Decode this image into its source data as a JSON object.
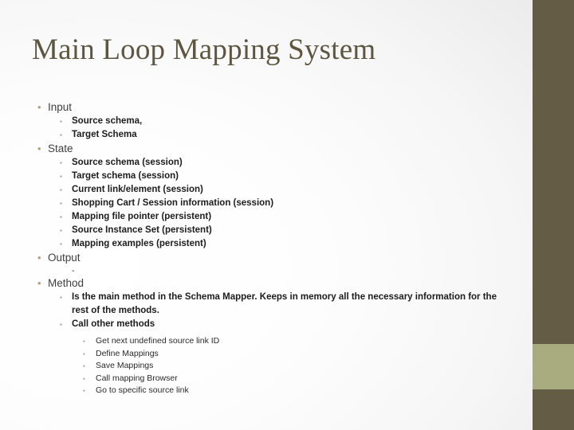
{
  "slide": {
    "title": "Main Loop Mapping System",
    "theme": {
      "title_color": "#5d5641",
      "bar_color": "#645c44",
      "bar_accent_color": "#a9ac7e",
      "level1_bullet_color": "#a9a383",
      "sub_bullet_color": "#8fa0a6",
      "background": "#ffffff"
    },
    "bullet_glyphs": {
      "level1": "•",
      "level2": "▪",
      "level3": "▪"
    },
    "outline": [
      {
        "level": 1,
        "text": "Input",
        "children": [
          {
            "level": 2,
            "text": "Source schema,"
          },
          {
            "level": 2,
            "text": "Target Schema"
          }
        ]
      },
      {
        "level": 1,
        "text": "State",
        "children": [
          {
            "level": 2,
            "text": "Source schema (session)"
          },
          {
            "level": 2,
            "text": "Target schema (session)"
          },
          {
            "level": 2,
            "text": "Current link/element (session)"
          },
          {
            "level": 2,
            "text": "Shopping Cart / Session information (session)"
          },
          {
            "level": 2,
            "text": "Mapping file pointer (persistent)"
          },
          {
            "level": 2,
            "text": "Source Instance Set (persistent)"
          },
          {
            "level": 2,
            "text": "Mapping examples (persistent)"
          }
        ]
      },
      {
        "level": 1,
        "text": "Output",
        "children": [
          {
            "level": 2,
            "text": "-",
            "style": "dash"
          }
        ]
      },
      {
        "level": 1,
        "text": "Method",
        "children": [
          {
            "level": 2,
            "text": "Is the main method in the Schema Mapper. Keeps in memory all the necessary information for the rest of the methods."
          },
          {
            "level": 2,
            "text": "Call other methods"
          },
          {
            "level": 3,
            "text": "Get next  undefined source link ID"
          },
          {
            "level": 3,
            "text": "Define Mappings"
          },
          {
            "level": 3,
            "text": "Save Mappings"
          },
          {
            "level": 3,
            "text": "Call mapping Browser"
          },
          {
            "level": 3,
            "text": "Go to specific source link"
          }
        ]
      }
    ]
  }
}
